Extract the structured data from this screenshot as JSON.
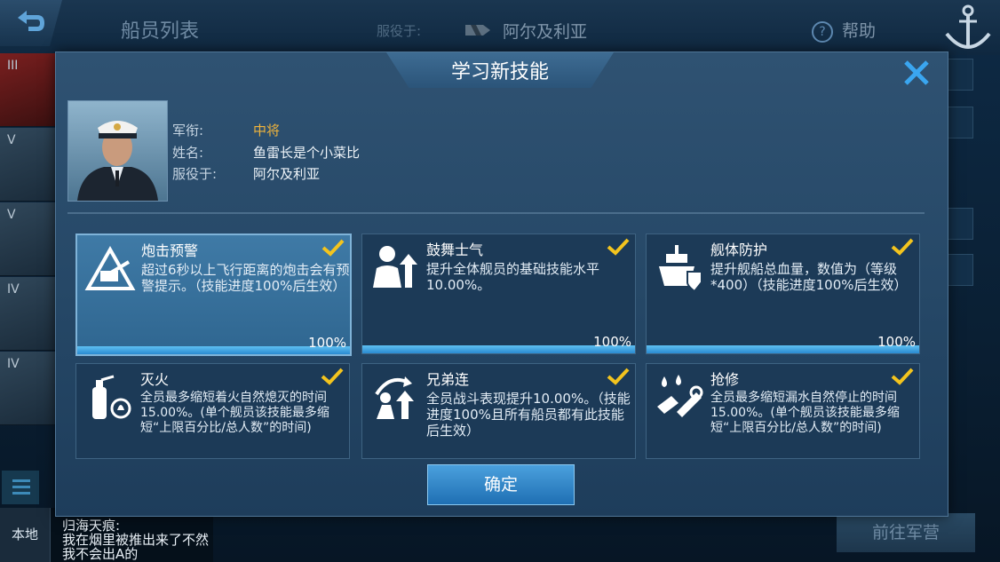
{
  "background": {
    "title": "船员列表",
    "serve_label": "服役于:",
    "nation": "阿尔及利亚",
    "help": "帮助",
    "ship_tiers": [
      "III",
      "V",
      "V",
      "IV",
      "IV"
    ],
    "chat": {
      "channel": "本地",
      "sender": "归海天痕:",
      "message": "我在烟里被推出来了不然我不会出A的"
    },
    "goto_button": "前往军营"
  },
  "dialog": {
    "title": "学习新技能",
    "rank_label": "军衔:",
    "rank_value": "中将",
    "name_label": "姓名:",
    "name_value": "鱼雷长是个小菜比",
    "serve_label": "服役于:",
    "serve_value": "阿尔及利亚",
    "skills": [
      {
        "name": "炮击预警",
        "desc": "超过6秒以上飞行距离的炮击会有预警提示。（技能进度100%后生效）",
        "progress": "100%",
        "icon": "artillery-warning-icon"
      },
      {
        "name": "鼓舞士气",
        "desc": "提升全体舰员的基础技能水平10.00%。",
        "progress": "100%",
        "icon": "morale-icon"
      },
      {
        "name": "舰体防护",
        "desc": "提升舰船总血量，数值为（等级*400）（技能进度100%后生效）",
        "progress": "100%",
        "icon": "hull-protection-icon"
      },
      {
        "name": "灭火",
        "desc": "全员最多缩短着火自然熄灭的时间15.00%。(单个舰员该技能最多缩短“上限百分比/总人数”的时间)",
        "icon": "fire-extinguisher-icon"
      },
      {
        "name": "兄弟连",
        "desc": "全员战斗表现提升10.00%。（技能进度100%且所有船员都有此技能后生效）",
        "icon": "brotherhood-icon"
      },
      {
        "name": "抢修",
        "desc": "全员最多缩短漏水自然停止的时间15.00%。(单个舰员该技能最多缩短“上限百分比/总人数”的时间)",
        "icon": "repair-icon"
      }
    ],
    "confirm_button": "确定"
  },
  "colors": {
    "accent": "#4aa0dd",
    "rank": "#f0b43c",
    "check": "#f3c41e",
    "progress": "#3aa2e3"
  }
}
